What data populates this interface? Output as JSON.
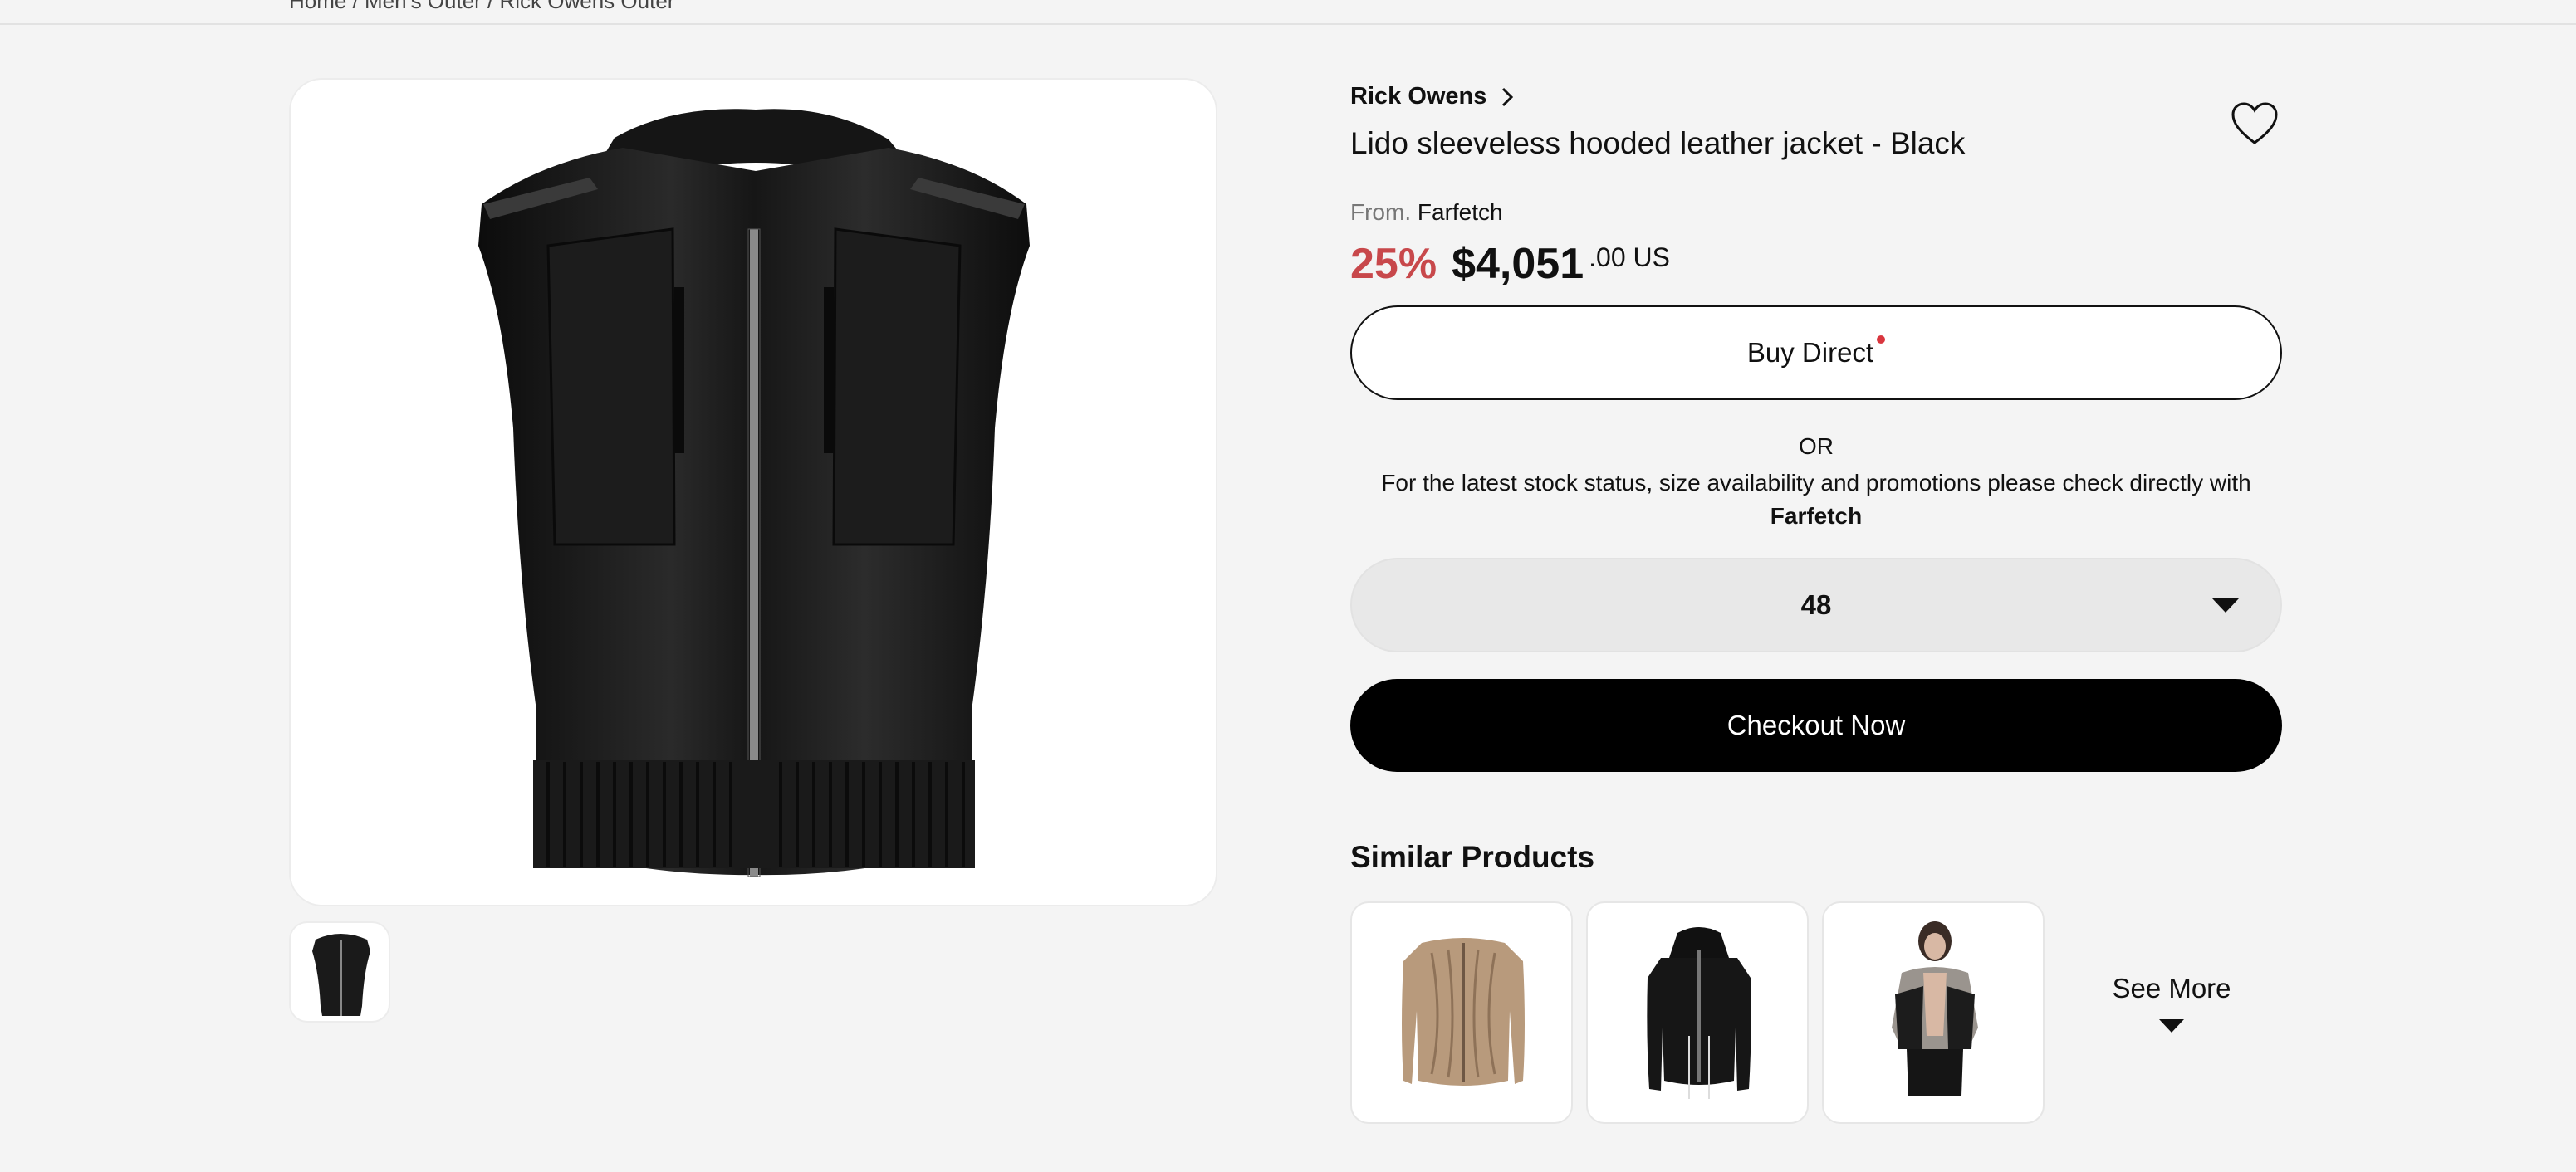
{
  "breadcrumb": {
    "text": "Home / Men's Outer / Rick Owens Outer"
  },
  "product": {
    "brand": "Rick Owens",
    "title": "Lido sleeveless hooded leather jacket - Black",
    "from_label": "From.",
    "store": "Farfetch",
    "discount": "25%",
    "price_main": "$4,051",
    "price_cents": ".00 US"
  },
  "actions": {
    "buy_direct": "Buy Direct",
    "or": "OR",
    "stock_note": "For the latest stock status, size availability and promotions please check directly with",
    "stock_store": "Farfetch",
    "size_selected": "48",
    "checkout": "Checkout Now"
  },
  "similar": {
    "title": "Similar Products",
    "see_more": "See More"
  },
  "colors": {
    "discount": "#c8484b",
    "primary_button": "#000000",
    "notification_dot": "#d9363e"
  },
  "icons": [
    "chevron-right-icon",
    "heart-icon",
    "chevron-down-icon",
    "triangle-down-icon"
  ]
}
